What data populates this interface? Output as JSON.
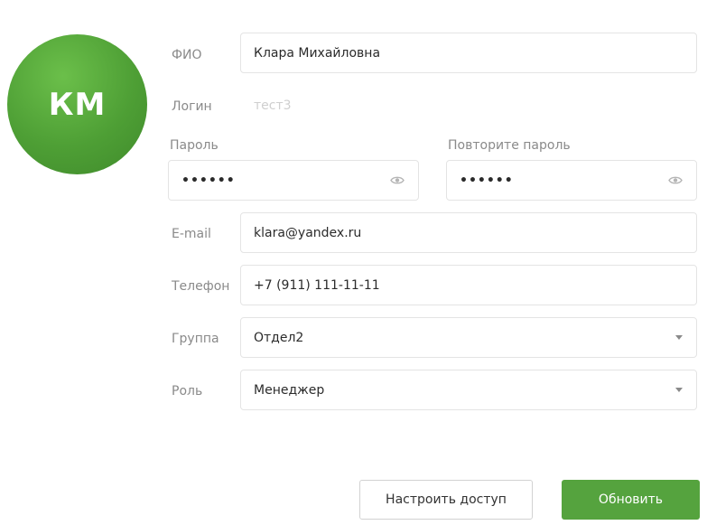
{
  "avatar": {
    "initials": "КМ"
  },
  "form": {
    "fio": {
      "label": "ФИО",
      "value": "Клара Михайловна"
    },
    "login": {
      "label": "Логин",
      "value": "тест3"
    },
    "password": {
      "label": "Пароль",
      "value": "••••••"
    },
    "password_repeat": {
      "label": "Повторите пароль",
      "value": "••••••"
    },
    "email": {
      "label": "E-mail",
      "value": "klara@yandex.ru"
    },
    "phone": {
      "label": "Телефон",
      "value": "+7 (911) 111-11-11"
    },
    "group": {
      "label": "Группа",
      "value": "Отдел2"
    },
    "role": {
      "label": "Роль",
      "value": "Менеджер"
    }
  },
  "actions": {
    "configure_access": "Настроить доступ",
    "update": "Обновить"
  },
  "colors": {
    "accent": "#55a33e",
    "avatar": "#4e9f35"
  },
  "icons": {
    "password_toggle": "eye-icon",
    "dropdown": "chevron-down-icon"
  }
}
